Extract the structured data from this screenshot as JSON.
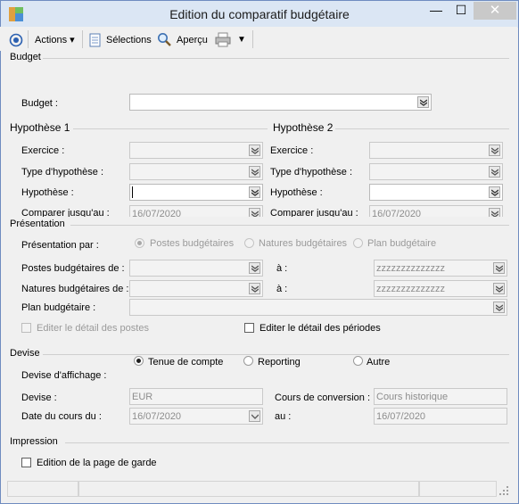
{
  "window": {
    "title": "Edition du comparatif budgétaire",
    "close_glyph": "✕",
    "min_glyph": "—",
    "max_glyph": "☐"
  },
  "toolbar": {
    "actions_label": "Actions",
    "selections_label": "Sélections",
    "preview_label": "Aperçu"
  },
  "budget": {
    "section": "Budget",
    "budget_label": "Budget :",
    "budget_value": ""
  },
  "hyp1": {
    "section": "Hypothèse 1",
    "exercice_label": "Exercice :",
    "type_label": "Type d'hypothèse :",
    "hyp_label": "Hypothèse :",
    "compare_label": "Comparer jusqu'au :",
    "compare_value": "16/07/2020"
  },
  "hyp2": {
    "section": "Hypothèse 2",
    "exercice_label": "Exercice :",
    "type_label": "Type d'hypothèse :",
    "hyp_label": "Hypothèse :",
    "compare_label": "Comparer jusqu'au :",
    "compare_value": "16/07/2020"
  },
  "presentation": {
    "section": "Présentation",
    "par_label": "Présentation par :",
    "opt_postes": "Postes budgétaires",
    "opt_natures": "Natures budgétaires",
    "opt_plan": "Plan budgétaire",
    "postes_label": "Postes budgétaires de :",
    "postes_to_label": "à :",
    "postes_to_value": "zzzzzzzzzzzzzz",
    "natures_label": "Natures budgétaires de :",
    "natures_to_label": "à :",
    "natures_to_value": "zzzzzzzzzzzzzz",
    "plan_label": "Plan budgétaire :",
    "detail_postes": "Editer le détail des postes",
    "detail_periodes": "Editer le détail des périodes"
  },
  "devise": {
    "section": "Devise",
    "affichage_label": "Devise d'affichage :",
    "opt_tenue": "Tenue de compte",
    "opt_reporting": "Reporting",
    "opt_autre": "Autre",
    "devise_label": "Devise :",
    "devise_value": "EUR",
    "cours_label": "Cours de conversion :",
    "cours_value": "Cours historique",
    "date_label": "Date du cours du :",
    "date_value": "16/07/2020",
    "au_label": "au :",
    "au_value": "16/07/2020"
  },
  "impression": {
    "section": "Impression",
    "page_garde": "Edition de la page de garde"
  }
}
